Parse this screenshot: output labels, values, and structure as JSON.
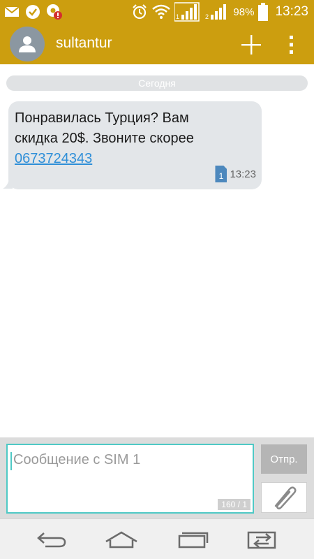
{
  "status_bar": {
    "battery_percent": "98%",
    "time": "13:23",
    "icons": [
      "mail-icon",
      "check-icon",
      "notification-icon",
      "alarm-icon",
      "wifi-icon",
      "signal-sim1-icon",
      "signal-sim2-icon",
      "battery-icon"
    ]
  },
  "header": {
    "contact_name": "sultantur",
    "icons": [
      "avatar-person-icon",
      "plus-icon",
      "overflow-menu-icon"
    ]
  },
  "conversation": {
    "date_divider": "Сегодня",
    "message": {
      "line1": "Понравилась Турция? Вам",
      "line2": "скидка 20$. Звоните скорее",
      "phone_link": "0673724343",
      "sim_label": "1",
      "time": "13:23"
    }
  },
  "compose": {
    "placeholder": "Сообщение с SIM 1",
    "counter": "160 / 1",
    "send_label": "Отпр.",
    "attach_icon": "paperclip-icon"
  },
  "nav": {
    "icons": [
      "back-icon",
      "home-icon",
      "recent-apps-icon",
      "dual-window-icon"
    ]
  },
  "colors": {
    "header": "#cc9e0f",
    "bubble": "#e3e6e9",
    "link": "#2f8fd8",
    "input_border": "#4fc9c5"
  }
}
